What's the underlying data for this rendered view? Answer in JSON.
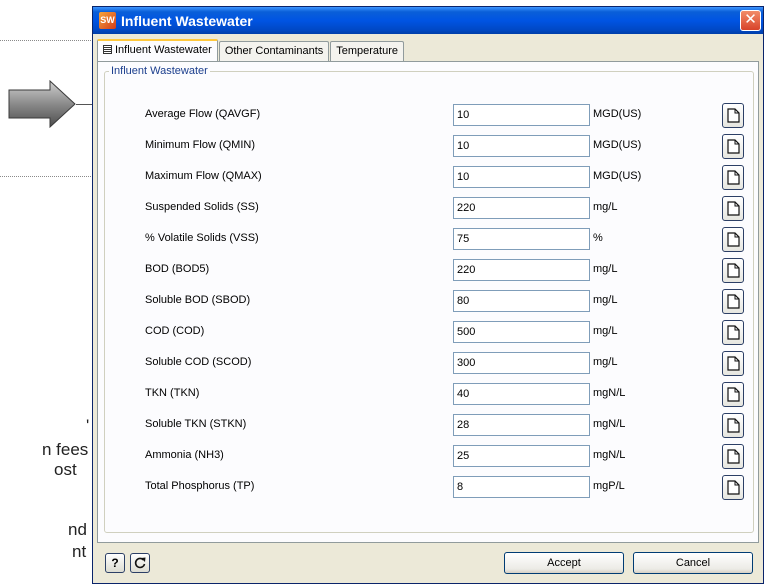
{
  "background_text": [
    "'",
    "n fees",
    "ost",
    "nd",
    "nt"
  ],
  "dialog": {
    "title": "Influent Wastewater",
    "close_symbol": "✕",
    "tabs": [
      {
        "label": "Influent Wastewater",
        "active": true
      },
      {
        "label": "Other Contaminants",
        "active": false
      },
      {
        "label": "Temperature",
        "active": false
      }
    ],
    "group_title": "Influent Wastewater",
    "rows": [
      {
        "label": "Average Flow (QAVGF)",
        "value": "10",
        "unit": "MGD(US)"
      },
      {
        "label": "Minimum Flow (QMIN)",
        "value": "10",
        "unit": "MGD(US)"
      },
      {
        "label": "Maximum Flow (QMAX)",
        "value": "10",
        "unit": "MGD(US)"
      },
      {
        "label": "Suspended Solids (SS)",
        "value": "220",
        "unit": "mg/L"
      },
      {
        "label": "% Volatile Solids (VSS)",
        "value": "75",
        "unit": "%"
      },
      {
        "label": "BOD (BOD5)",
        "value": "220",
        "unit": "mg/L"
      },
      {
        "label": "Soluble BOD (SBOD)",
        "value": "80",
        "unit": "mg/L"
      },
      {
        "label": "COD (COD)",
        "value": "500",
        "unit": "mg/L"
      },
      {
        "label": "Soluble COD (SCOD)",
        "value": "300",
        "unit": "mg/L"
      },
      {
        "label": "TKN (TKN)",
        "value": "40",
        "unit": "mgN/L"
      },
      {
        "label": "Soluble TKN (STKN)",
        "value": "28",
        "unit": "mgN/L"
      },
      {
        "label": "Ammonia (NH3)",
        "value": "25",
        "unit": "mgN/L"
      },
      {
        "label": "Total Phosphorus (TP)",
        "value": "8",
        "unit": "mgP/L"
      }
    ],
    "row_button_icon": "note-page-icon",
    "help_button_symbol": "?",
    "refresh_button_icon": "refresh-icon",
    "accept_label": "Accept",
    "cancel_label": "Cancel"
  },
  "colors": {
    "title_bar": "#0054e3",
    "dialog_face": "#ece9d8",
    "group_title": "#1b3e8d",
    "close_button": "#d8432a",
    "active_tab_highlight": "#ffc83c"
  }
}
